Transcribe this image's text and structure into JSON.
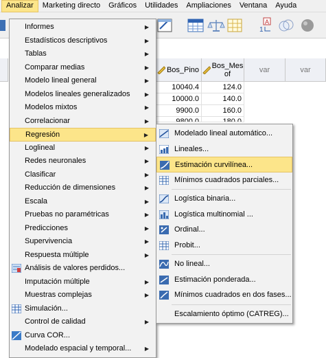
{
  "menubar": [
    "Analizar",
    "Marketing directo",
    "Gráficos",
    "Utilidades",
    "Ampliaciones",
    "Ventana",
    "Ayuda"
  ],
  "grid": {
    "columns": [
      "Bos_Pino",
      "Bos_Mes\nof",
      "var",
      "var"
    ],
    "rows": [
      [
        "10040.4",
        "124.0"
      ],
      [
        "10000.0",
        "140.0"
      ],
      [
        "9900.0",
        "160.0"
      ],
      [
        "9800.0",
        "180.0"
      ]
    ]
  },
  "analyze_menu": [
    {
      "label": "Informes",
      "arrow": true
    },
    {
      "label": "Estadísticos descriptivos",
      "arrow": true
    },
    {
      "label": "Tablas",
      "arrow": true
    },
    {
      "label": "Comparar medias",
      "arrow": true
    },
    {
      "label": "Modelo lineal general",
      "arrow": true
    },
    {
      "label": "Modelos lineales generalizados",
      "arrow": true
    },
    {
      "label": "Modelos mixtos",
      "arrow": true
    },
    {
      "label": "Correlacionar",
      "arrow": true
    },
    {
      "label": "Regresión",
      "arrow": true,
      "highlighted": true
    },
    {
      "label": "Loglineal",
      "arrow": true
    },
    {
      "label": "Redes neuronales",
      "arrow": true
    },
    {
      "label": "Clasificar",
      "arrow": true
    },
    {
      "label": "Reducción de dimensiones",
      "arrow": true
    },
    {
      "label": "Escala",
      "arrow": true
    },
    {
      "label": "Pruebas no paramétricas",
      "arrow": true
    },
    {
      "label": "Predicciones",
      "arrow": true
    },
    {
      "label": "Supervivencia",
      "arrow": true
    },
    {
      "label": "Respuesta múltiple",
      "arrow": true
    },
    {
      "label": "Análisis de valores perdidos...",
      "arrow": false,
      "icon": "missing-values-icon"
    },
    {
      "label": "Imputación múltiple",
      "arrow": true
    },
    {
      "label": "Muestras complejas",
      "arrow": true
    },
    {
      "label": "Simulación...",
      "arrow": false,
      "icon": "simulation-icon"
    },
    {
      "label": "Control de calidad",
      "arrow": true
    },
    {
      "label": "Curva COR...",
      "arrow": false,
      "icon": "roc-curve-icon"
    },
    {
      "label": "Modelado espacial y temporal...",
      "arrow": true
    }
  ],
  "regression_menu": [
    {
      "label": "Modelado lineal automático...",
      "icon": "auto-linear-icon"
    },
    {
      "label": "Lineales...",
      "icon": "linear-icon"
    },
    {
      "label": "Estimación curvilínea...",
      "icon": "curve-estimation-icon",
      "highlighted": true
    },
    {
      "label": "Mínimos cuadrados parciales...",
      "icon": "partial-least-squares-icon"
    },
    {
      "separator": true
    },
    {
      "label": "Logística binaria...",
      "icon": "binary-logistic-icon"
    },
    {
      "label": "Logística multinomial ...",
      "icon": "multinomial-logistic-icon"
    },
    {
      "label": "Ordinal...",
      "icon": "ordinal-icon"
    },
    {
      "label": "Probit...",
      "icon": "probit-icon"
    },
    {
      "separator": true
    },
    {
      "label": "No lineal...",
      "icon": "nonlinear-icon"
    },
    {
      "label": "Estimación ponderada...",
      "icon": "weight-estimation-icon"
    },
    {
      "label": "Mínimos cuadrados en dos fases...",
      "icon": "two-stage-least-squares-icon"
    },
    {
      "separator": true
    },
    {
      "label": "Escalamiento óptimo (CATREG)..."
    }
  ],
  "colors": {
    "highlight": "#fce58a",
    "highlight_border": "#e5c365",
    "menu_bg": "#f2f2f2"
  }
}
